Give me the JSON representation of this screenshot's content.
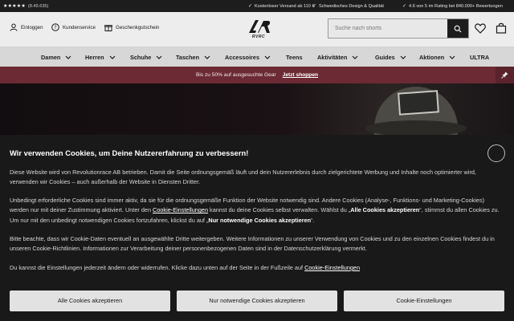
{
  "topbar": {
    "stars": "★★★★★",
    "rating_count": "(8.49.635)",
    "usps": [
      "Kostenloser Versand ab 110 €",
      "Schwedisches Design & Qualität",
      "4.6 von 5 im Rating bei 840.000+ Bewertungen"
    ]
  },
  "header": {
    "login": "Einloggen",
    "service": "Kundenservice",
    "giftcard": "Geschenkgutschein",
    "logo_text": "RVRC",
    "search_placeholder": "Suche nach shorts"
  },
  "nav": {
    "items": [
      {
        "label": "Damen",
        "has_dropdown": true
      },
      {
        "label": "Herren",
        "has_dropdown": true
      },
      {
        "label": "Schuhe",
        "has_dropdown": true
      },
      {
        "label": "Taschen",
        "has_dropdown": true
      },
      {
        "label": "Accessoires",
        "has_dropdown": true
      },
      {
        "label": "Teens",
        "has_dropdown": false
      },
      {
        "label": "Aktivitäten",
        "has_dropdown": true
      },
      {
        "label": "Guides",
        "has_dropdown": true
      },
      {
        "label": "Aktionen",
        "has_dropdown": true
      },
      {
        "label": "ULTRA",
        "has_dropdown": false
      }
    ]
  },
  "promo": {
    "text": "Bis zu 50% auf ausgesuchte Gear",
    "link": "Jetzt shoppen"
  },
  "cookie": {
    "title": "Wir verwenden Cookies, um Deine Nutzererfahrung zu verbessern!",
    "p1": "Diese Website wird von Revolutionrace AB betrieben. Damit die Seite ordnungsgemäß läuft und dein Nutzererlebnis durch zielgerichtete Werbung und Inhalte noch optimierter wird, verwenden wir Cookies – auch außerhalb der Website in Diensten Dritter.",
    "p2_a": "Unbedingt erforderliche Cookies sind immer aktiv, da sie für die ordnungsgemäße Funktion der Website notwendig sind. Andere Cookies (Analyse-, Funktions- und Marketing-Cookies) werden nur mit deiner Zustimmung aktiviert. Unter den ",
    "p2_link": "Cookie-Einstellungen",
    "p2_b": " kannst du deine Cookies selbst verwalten. Wählst du „",
    "p2_bold1": "Alle Cookies akzeptieren",
    "p2_c": "“, stimmst du allen Cookies zu. Um nur mit den unbedingt notwendigen Cookies fortzufahren, klickst du auf „",
    "p2_bold2": "Nur notwendige Cookies akzeptieren",
    "p2_d": "“.",
    "p3": "Bitte beachte, dass wir Cookie-Daten eventuell an ausgewählte Dritte weitergeben. Weitere Informationen zu unserer Verwendung von Cookies und zu den einzelnen Cookies findest du in unseren Cookie-Richtlinien. Informationen zur Verarbeitung deiner personenbezogenen Daten sind in der Datenschutzerklärung vermerkt.",
    "p4_a": "Du kannst die Einstellungen jederzeit ändern oder widerrufen. Klicke dazu unten auf der Seite in der Fußzeile auf ",
    "p4_link": "Cookie-Einstellungen",
    "buttons": {
      "accept_all": "Alle Cookies akzeptieren",
      "necessary_only": "Nur notwendige Cookies akzeptieren",
      "settings": "Cookie-Einstellungen"
    }
  }
}
